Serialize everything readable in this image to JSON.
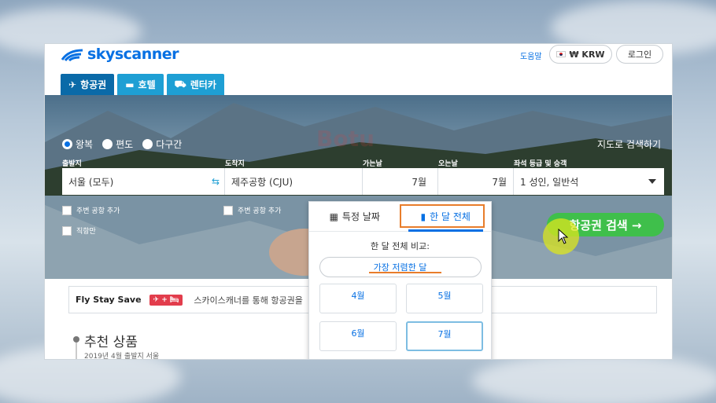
{
  "header": {
    "logo_text": "skyscanner",
    "help_link": "도움말",
    "currency": "₩ KRW",
    "login": "로그인"
  },
  "tabs": [
    {
      "label": "항공권",
      "icon": "airplane-icon"
    },
    {
      "label": "호텔",
      "icon": "bed-icon"
    },
    {
      "label": "렌터카",
      "icon": "car-icon"
    }
  ],
  "search": {
    "trip_types": [
      "왕복",
      "편도",
      "다구간"
    ],
    "selected_trip_type": "왕복",
    "map_search": "지도로 검색하기",
    "labels": {
      "origin": "출발지",
      "destination": "도착지",
      "depart": "가는날",
      "return": "오는날",
      "cabin": "좌석 등급 및 승객"
    },
    "values": {
      "origin": "서울 (모두)",
      "destination": "제주공항 (CJU)",
      "depart": "7월",
      "return": "7월",
      "cabin": "1 성인, 일반석"
    },
    "nearby_origin": "주변 공항 추가",
    "nearby_destination": "주변 공항 추가",
    "direct_only": "직항만",
    "submit": "항공권 검색 →"
  },
  "popup": {
    "tab_specific": "특정 날짜",
    "tab_month": "한 달 전체",
    "compare_label": "한 달 전체 비교:",
    "cheapest": "가장 저렴한 달",
    "months": [
      "4월",
      "5월",
      "6월",
      "7월"
    ],
    "selected_month": "7월"
  },
  "promo": {
    "title": "Fly Stay Save",
    "badge": "✈ + 🛏",
    "text": "스카이스캐너를 통해 항공권을"
  },
  "recommend": {
    "title": "추천 상품",
    "subtitle": "2019년 4월    출발지 서울"
  },
  "watermark": "Botu",
  "colors": {
    "brand": "#0770e3",
    "tab": "#1e9fd4",
    "tab_active": "#0a6aa8",
    "search_button": "#3fbf4b",
    "highlight": "#e87d2b"
  }
}
